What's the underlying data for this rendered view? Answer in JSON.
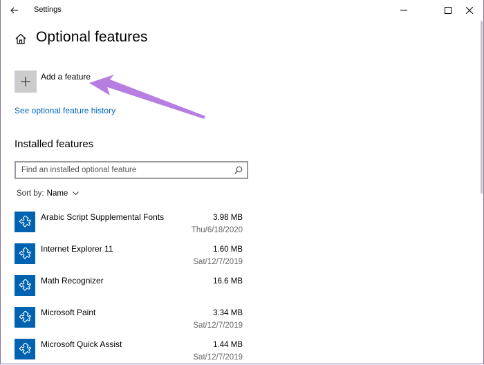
{
  "window": {
    "title": "Settings"
  },
  "page": {
    "title": "Optional features"
  },
  "add_feature": {
    "label": "Add a feature"
  },
  "history_link": "See optional feature history",
  "installed": {
    "heading": "Installed features",
    "search_placeholder": "Find an installed optional feature",
    "sort_label": "Sort by:",
    "sort_value": "Name"
  },
  "features": [
    {
      "name": "Arabic Script Supplemental Fonts",
      "size": "3.98 MB",
      "date": "Thu/6/18/2020"
    },
    {
      "name": "Internet Explorer 11",
      "size": "1.60 MB",
      "date": "Sat/12/7/2019"
    },
    {
      "name": "Math Recognizer",
      "size": "16.6 MB",
      "date": ""
    },
    {
      "name": "Microsoft Paint",
      "size": "3.34 MB",
      "date": "Sat/12/7/2019"
    },
    {
      "name": "Microsoft Quick Assist",
      "size": "1.44 MB",
      "date": "Sat/12/7/2019"
    }
  ],
  "colors": {
    "accent": "#0063b1",
    "link": "#0067b8",
    "annotation_arrow": "#b57ee0"
  },
  "icons": {
    "back": "back-arrow-icon",
    "home": "home-icon",
    "add": "plus-icon",
    "search": "search-icon",
    "feature": "puzzle-piece-icon"
  }
}
